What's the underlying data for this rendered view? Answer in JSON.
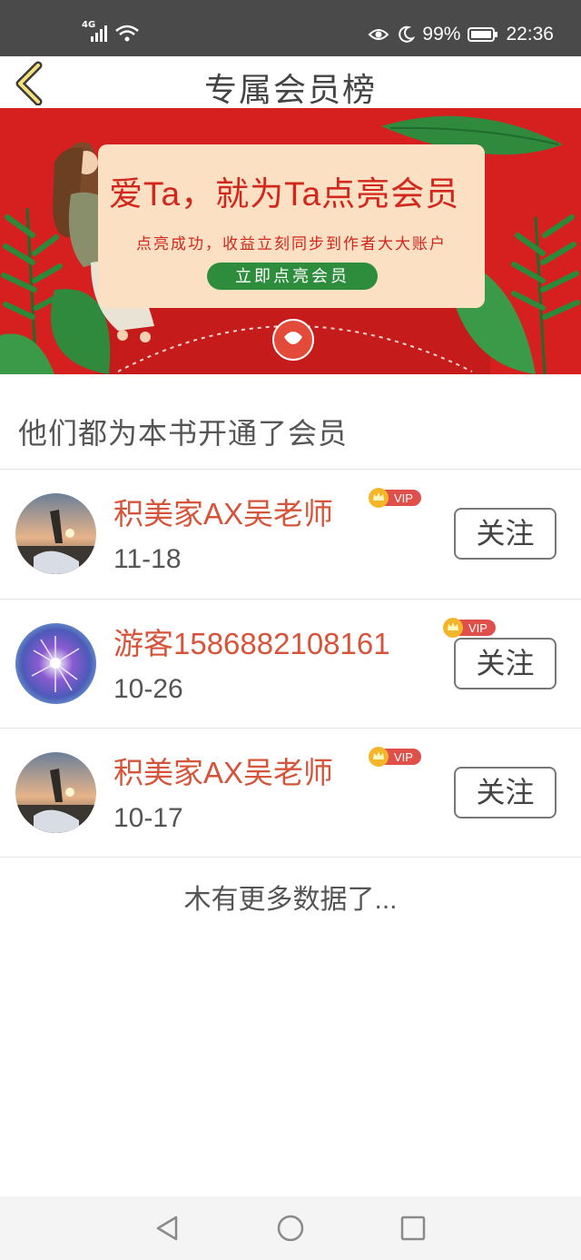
{
  "status_bar": {
    "network": "4G",
    "battery": "99%",
    "time": "22:36",
    "icons": [
      "signal-icon",
      "wifi-icon",
      "eye-icon",
      "moon-icon",
      "battery-icon"
    ]
  },
  "header": {
    "title": "专属会员榜",
    "back_icon": "chevron-left-icon"
  },
  "banner": {
    "title": "爱Ta，就为Ta点亮会员",
    "subtitle": "点亮成功，收益立刻同步到作者大大账户",
    "cta": "立即点亮会员",
    "colors": {
      "background": "#d62020",
      "card": "#fbe0c4",
      "cta": "#2e8d3c",
      "text": "#d1271c"
    }
  },
  "section": {
    "heading": "他们都为本书开通了会员"
  },
  "members": [
    {
      "name": "积美家AX吴老师",
      "date": "11-18",
      "badge": "VIP",
      "follow_label": "关注",
      "avatar": "sunset-avatar"
    },
    {
      "name": "游客1586882108161",
      "date": "10-26",
      "badge": "VIP",
      "follow_label": "关注",
      "avatar": "flower-avatar"
    },
    {
      "name": "积美家AX吴老师",
      "date": "10-17",
      "badge": "VIP",
      "follow_label": "关注",
      "avatar": "sunset-avatar"
    }
  ],
  "footer_note": "木有更多数据了...",
  "nav_bar": {
    "icons": [
      "back-triangle-icon",
      "home-circle-icon",
      "recents-square-icon"
    ]
  },
  "colors": {
    "accent_name": "#d6553a",
    "status_bar": "#4a4a4a",
    "vip_gold": "#f3b52a",
    "vip_red": "#e0504a"
  }
}
